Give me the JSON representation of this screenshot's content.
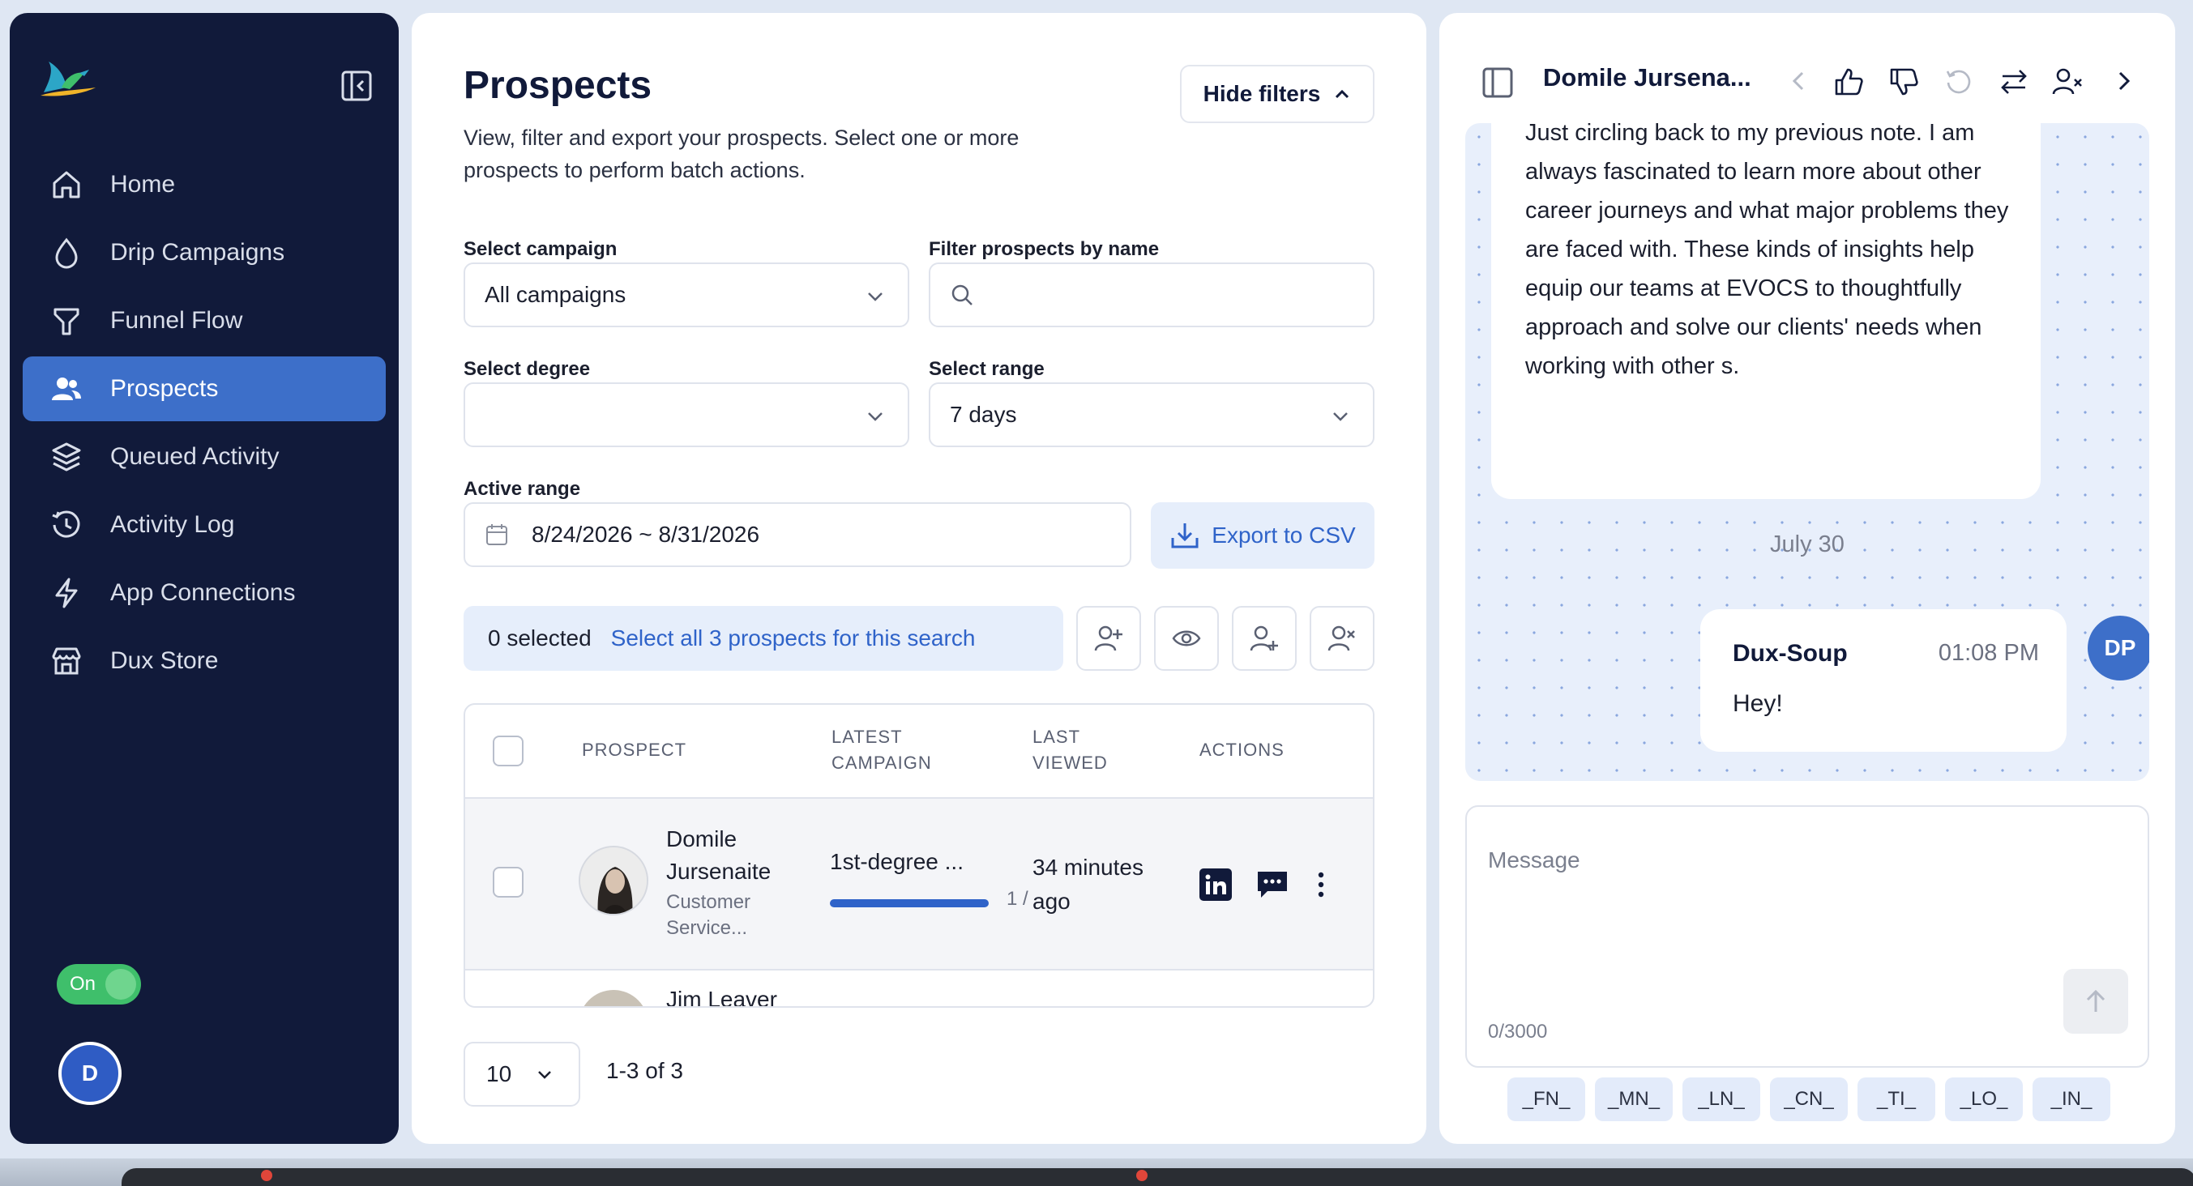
{
  "sidebar": {
    "collapse_icon": "sidebar-collapse-icon",
    "items": [
      {
        "label": "Home",
        "icon": "home-icon"
      },
      {
        "label": "Drip Campaigns",
        "icon": "drop-icon"
      },
      {
        "label": "Funnel Flow",
        "icon": "funnel-icon"
      },
      {
        "label": "Prospects",
        "icon": "users-icon",
        "active": true
      },
      {
        "label": "Queued Activity",
        "icon": "layers-icon"
      },
      {
        "label": "Activity Log",
        "icon": "history-icon"
      },
      {
        "label": "App Connections",
        "icon": "bolt-icon"
      },
      {
        "label": "Dux Store",
        "icon": "store-icon"
      }
    ],
    "toggle_label": "On",
    "user_initial": "D"
  },
  "main": {
    "title": "Prospects",
    "description": "View, filter and export your prospects. Select one or more prospects to perform batch actions.",
    "hide_filters_label": "Hide filters",
    "select_campaign_label": "Select campaign",
    "select_campaign_value": "All campaigns",
    "filter_name_label": "Filter prospects by name",
    "filter_name_value": "",
    "select_degree_label": "Select degree",
    "select_degree_value": "",
    "select_range_label": "Select range",
    "select_range_value": "7 days",
    "active_range_label": "Active range",
    "active_range_value": "8/24/2026 ~ 8/31/2026",
    "export_label": "Export to CSV",
    "selected_count": "0 selected",
    "select_all_label": "Select all 3 prospects for this search",
    "table": {
      "headers": {
        "prospect": "PROSPECT",
        "latest_campaign_1": "LATEST",
        "latest_campaign_2": "CAMPAIGN",
        "last_viewed_1": "LAST",
        "last_viewed_2": "VIEWED",
        "actions": "ACTIONS"
      },
      "rows": [
        {
          "name_line1": "Domile",
          "name_line2": "Jursenaite",
          "title_line1": "Customer",
          "title_line2": "Service...",
          "campaign": "1st-degree ...",
          "progress_text": "1 /",
          "progress_fraction": 1.0,
          "viewed_line1": "34 minutes",
          "viewed_line2": "ago"
        },
        {
          "name_partial": "Jim Leaver"
        }
      ]
    },
    "page_size": "10",
    "page_range": "1-3 of 3"
  },
  "chat": {
    "contact_name": "Domile Jursena...",
    "incoming_message": "Just circling back to my previous note. I am always fascinated to learn more about other career journeys and what major problems they are faced with. These kinds of insights help equip our teams at EVOCS to thoughtfully approach and solve our clients' needs when working with other s.",
    "date_separator": "July 30",
    "outgoing": {
      "sender": "Dux-Soup",
      "time": "01:08 PM",
      "message": "Hey!",
      "avatar_initials": "DP"
    },
    "compose_placeholder": "Message",
    "char_counter": "0/3000",
    "tokens": [
      "_FN_",
      "_MN_",
      "_LN_",
      "_CN_",
      "_TI_",
      "_LO_",
      "_IN_"
    ]
  },
  "colors": {
    "sidebar_bg": "#111a3a",
    "accent": "#3d6fc9",
    "link_blue": "#2f63c9",
    "toggle_green": "#3fbf6b"
  }
}
